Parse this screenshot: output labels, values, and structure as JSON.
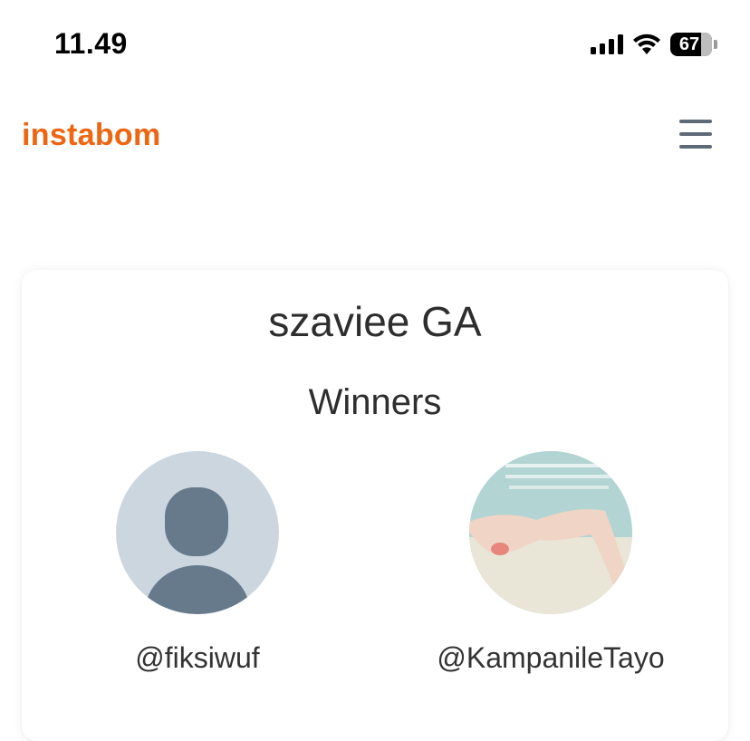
{
  "status_bar": {
    "time": "11.49",
    "battery": "67",
    "icons": [
      "cellular-signal-icon",
      "wifi-icon",
      "battery-icon"
    ]
  },
  "header": {
    "logo": "instabom",
    "menu_icon": "hamburger-menu-icon"
  },
  "colors": {
    "brand": "#ee6512",
    "menu_icon": "#5e6a76",
    "avatar_placeholder_bg": "#ccd6df",
    "avatar_placeholder_figure": "#667a8c"
  },
  "giveaway": {
    "title": "szaviee GA",
    "subtitle": "Winners",
    "winners": [
      {
        "handle": "@fiksiwuf",
        "avatar": "default-avatar-icon"
      },
      {
        "handle": "@KampanileTayo",
        "avatar": "profile-photo"
      }
    ]
  }
}
